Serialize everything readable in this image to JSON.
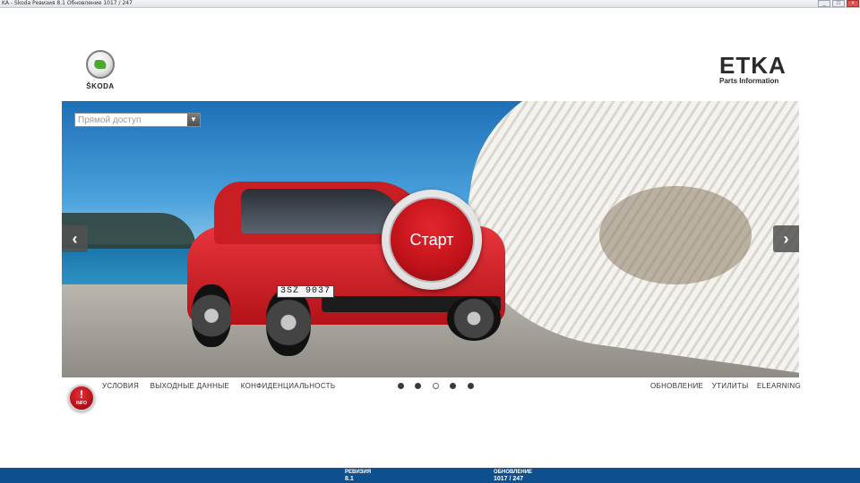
{
  "window": {
    "title": "KA - Skoda Ревизия 8.1 Обновление 1017 / 247",
    "controls": [
      "minimize",
      "maximize",
      "close"
    ]
  },
  "brand": {
    "skoda_word": "ŠKODA",
    "etka_big": "ETKA",
    "etka_small": "Parts Information",
    "skoda_green": "#4ba82e"
  },
  "direct_access": {
    "placeholder": "Прямой доступ"
  },
  "hero": {
    "start_label": "Старт",
    "plate": "3SZ 9037",
    "prev_icon": "chevron-left-icon",
    "next_icon": "chevron-right-icon",
    "start_color": "#c1121a"
  },
  "info_button": {
    "mark": "!",
    "label": "INFO"
  },
  "links_left": [
    "Условия",
    "Выходные данные",
    "Конфиденциальность"
  ],
  "links_right": [
    "Обновление",
    "Утилиты",
    "Elearning"
  ],
  "carousel": {
    "count": 5,
    "active_index": 2
  },
  "footer": {
    "revision_label": "РЕВИЗИЯ",
    "revision_value": "8.1",
    "update_label": "ОБНОВЛЕНИЕ",
    "update_value": "1017 / 247",
    "color": "#0e4f8d"
  }
}
